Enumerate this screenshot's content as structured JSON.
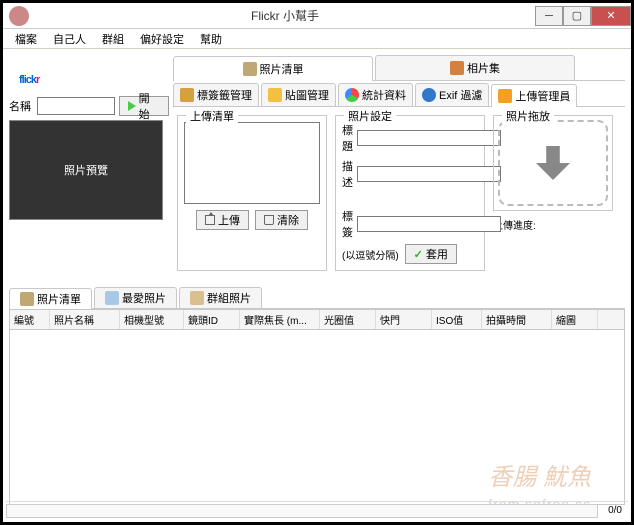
{
  "window": {
    "title": "Flickr 小幫手"
  },
  "menu": [
    "檔案",
    "自己人",
    "群組",
    "偏好設定",
    "幫助"
  ],
  "logo": {
    "prefix": "flick",
    "suffix": "r"
  },
  "left": {
    "name_label": "名稱",
    "start_label": "開始",
    "preview_label": "照片預覽"
  },
  "main_tabs": {
    "photo_list": "照片清單",
    "album": "相片集"
  },
  "sub_tabs": {
    "tag_mgr": "標簽籤管理",
    "pic_mgr": "貼圖管理",
    "stats": "統計資料",
    "exif": "Exif 過濾",
    "upload_mgr": "上傳管理員"
  },
  "upload_group": {
    "legend": "上傳清單",
    "upload_btn": "上傳",
    "clear_btn": "清除"
  },
  "photo_group": {
    "legend": "照片設定",
    "title_label": "標題",
    "desc_label": "描述",
    "tag_label": "標簽",
    "note": "(以逗號分隔)",
    "apply_btn": "套用"
  },
  "drop_group": {
    "legend": "照片拖放",
    "progress": "上傳進度:"
  },
  "bottom_tabs": {
    "photo_list": "照片清單",
    "fav": "最愛照片",
    "group": "群組照片"
  },
  "columns": [
    "編號",
    "照片名稱",
    "相機型號",
    "鏡頭ID",
    "實際焦長 (m...",
    "光圈值",
    "快門",
    "ISO值",
    "拍攝時間",
    "縮圖"
  ],
  "status": {
    "counter": "0/0"
  },
  "watermark1": "香腸   魷魚",
  "watermark2": "from sofree.cc"
}
